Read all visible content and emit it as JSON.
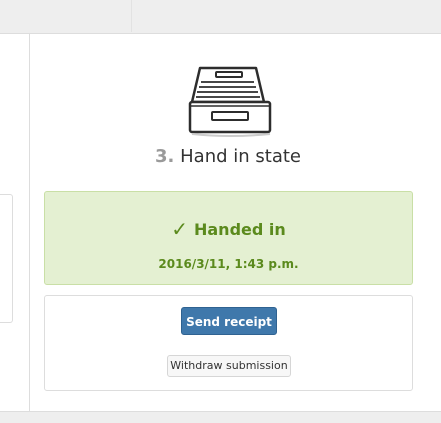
{
  "state_section": {
    "step_number": "3.",
    "title": "Hand in state",
    "tray_icon": "document-tray-icon"
  },
  "status": {
    "check_icon": "✓",
    "label": "Handed in",
    "timestamp": "2016/3/11, 1:43 p.m.",
    "color": "#5b8a1d",
    "background": "#e4f0d2"
  },
  "actions": {
    "send_receipt_label": "Send receipt",
    "withdraw_label": "Withdraw submission",
    "primary_color": "#3f78ab"
  }
}
